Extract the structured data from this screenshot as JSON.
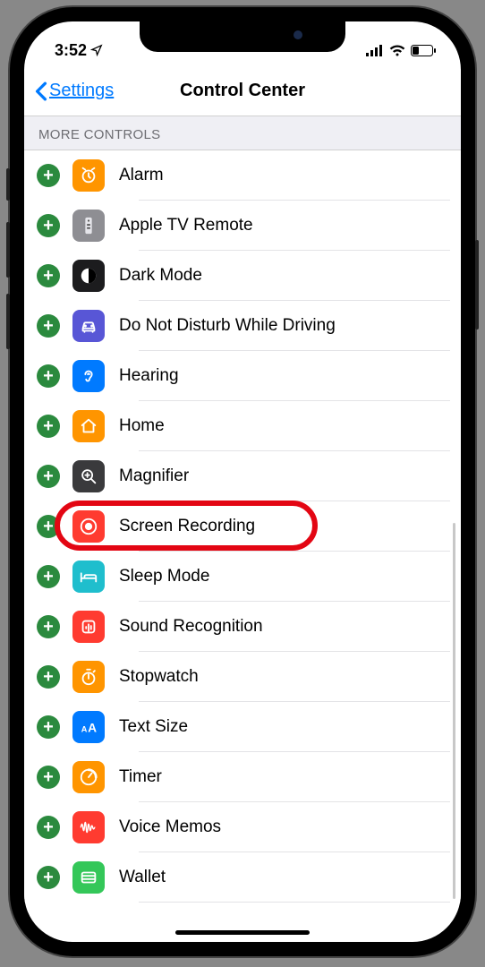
{
  "statusbar": {
    "time": "3:52"
  },
  "nav": {
    "back": "Settings",
    "title": "Control Center"
  },
  "section": {
    "header": "MORE CONTROLS"
  },
  "controls": [
    {
      "label": "Alarm",
      "icon": "alarm",
      "bg": "#ff9500"
    },
    {
      "label": "Apple TV Remote",
      "icon": "remote",
      "bg": "#8e8e93"
    },
    {
      "label": "Dark Mode",
      "icon": "darkmode",
      "bg": "#1c1c1e"
    },
    {
      "label": "Do Not Disturb While Driving",
      "icon": "car",
      "bg": "#5856d6"
    },
    {
      "label": "Hearing",
      "icon": "ear",
      "bg": "#007aff"
    },
    {
      "label": "Home",
      "icon": "home",
      "bg": "#ff9500"
    },
    {
      "label": "Magnifier",
      "icon": "magnifier",
      "bg": "#3a3a3c"
    },
    {
      "label": "Screen Recording",
      "icon": "record",
      "bg": "#ff3b30",
      "highlighted": true
    },
    {
      "label": "Sleep Mode",
      "icon": "bed",
      "bg": "#1fbecd"
    },
    {
      "label": "Sound Recognition",
      "icon": "sound",
      "bg": "#ff3b30"
    },
    {
      "label": "Stopwatch",
      "icon": "stopwatch",
      "bg": "#ff9500"
    },
    {
      "label": "Text Size",
      "icon": "textsize",
      "bg": "#007aff"
    },
    {
      "label": "Timer",
      "icon": "timer",
      "bg": "#ff9500"
    },
    {
      "label": "Voice Memos",
      "icon": "voicememo",
      "bg": "#ff3b30"
    },
    {
      "label": "Wallet",
      "icon": "wallet",
      "bg": "#34c759"
    }
  ]
}
